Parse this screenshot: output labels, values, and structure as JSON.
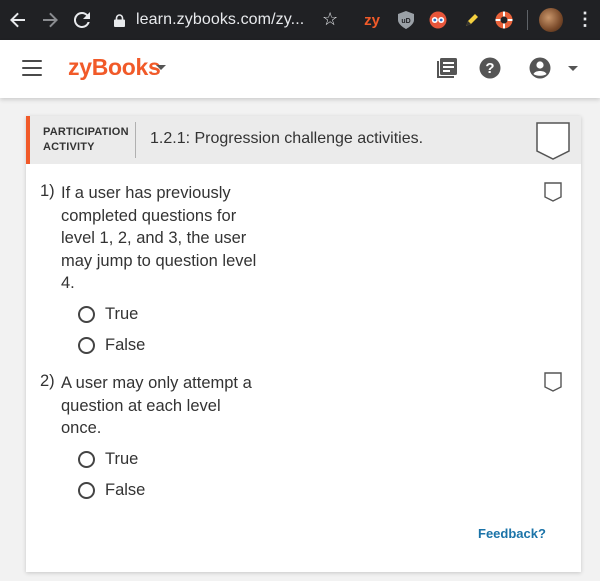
{
  "browser": {
    "url": "learn.zybooks.com/zy...",
    "extensions": [
      "zy-extension-icon",
      "ublock-icon",
      "eye-extension-icon",
      "highlighter-icon",
      "lifesaver-icon"
    ],
    "zy_ext_label": "zy"
  },
  "header": {
    "brand": "zyBooks",
    "brand_color": "#f15a29"
  },
  "activity": {
    "type_label_line1": "PARTICIPATION",
    "type_label_line2": "ACTIVITY",
    "title": "1.2.1: Progression challenge activities.",
    "accent_color": "#f15a29",
    "questions": [
      {
        "number": "1)",
        "text": "If a user has previously completed questions for level 1, 2, and 3, the user may jump to question level 4.",
        "options": [
          "True",
          "False"
        ]
      },
      {
        "number": "2)",
        "text": "A user may only attempt a question at each level once.",
        "options": [
          "True",
          "False"
        ]
      }
    ],
    "feedback_link": "Feedback?"
  }
}
